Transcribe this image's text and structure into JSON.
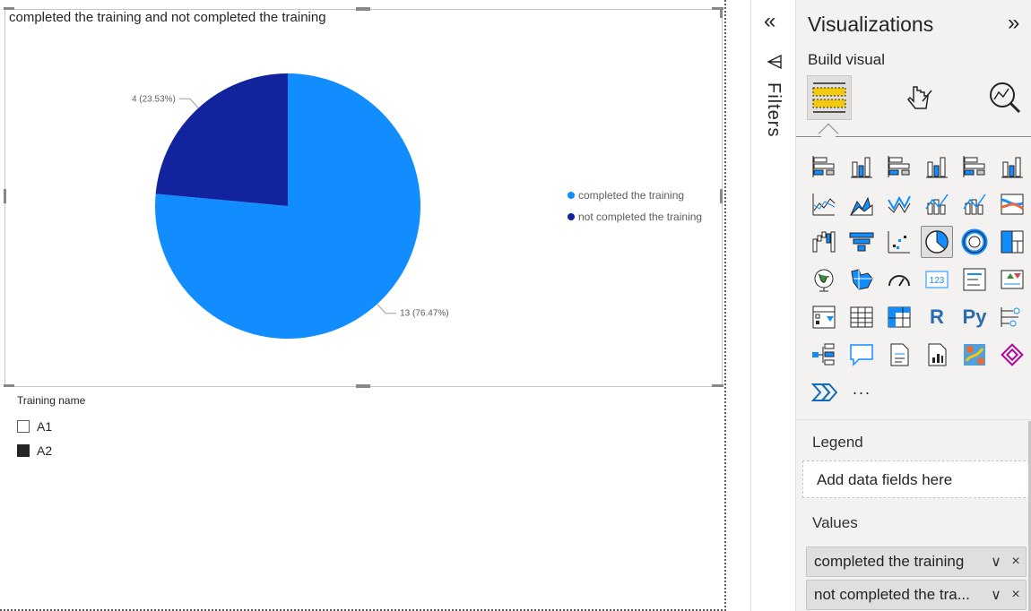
{
  "visual": {
    "title": "completed the training and not completed the training"
  },
  "chart_data": {
    "type": "pie",
    "title": "completed the training and not completed the training",
    "categories": [
      "completed the training",
      "not completed the training"
    ],
    "values": [
      13,
      4
    ],
    "percentages": [
      "76.47%",
      "23.53%"
    ],
    "data_labels": [
      "13 (76.47%)",
      "4 (23.53%)"
    ],
    "colors": [
      "#118DFF",
      "#12239E"
    ],
    "legend_position": "right"
  },
  "slicer": {
    "title": "Training name",
    "items": [
      {
        "label": "A1",
        "checked": false
      },
      {
        "label": "A2",
        "checked": true
      }
    ]
  },
  "filters": {
    "label": "Filters",
    "collapse_glyph": "«"
  },
  "viz_pane": {
    "title": "Visualizations",
    "expand_glyph": "»",
    "build_label": "Build visual",
    "tabs": [
      "build-visual-icon",
      "format-visual-icon",
      "analytics-icon"
    ],
    "selected_icon": "pie-chart-icon",
    "icons": [
      "stacked-bar-icon",
      "stacked-column-icon",
      "clustered-bar-icon",
      "clustered-column-icon",
      "100-stacked-bar-icon",
      "100-stacked-column-icon",
      "line-chart-icon",
      "area-chart-icon",
      "stacked-area-icon",
      "line-clustered-column-icon",
      "line-stacked-column-icon",
      "ribbon-chart-icon",
      "waterfall-icon",
      "funnel-icon",
      "scatter-icon",
      "pie-chart-icon",
      "donut-chart-icon",
      "treemap-icon",
      "map-icon",
      "filled-map-icon",
      "gauge-icon",
      "card-icon",
      "multi-row-card-icon",
      "kpi-icon",
      "slicer-icon",
      "table-icon",
      "matrix-icon",
      "r-visual-icon",
      "python-visual-icon",
      "key-influencers-icon",
      "decomposition-tree-icon",
      "qna-icon",
      "smart-narrative-icon",
      "paginated-report-icon",
      "azure-map-icon",
      "power-apps-icon",
      "power-automate-icon",
      "more-visuals-icon"
    ],
    "r_text": "R",
    "py_text": "Py",
    "card_text": "123",
    "more_text": "···",
    "legend_label": "Legend",
    "legend_placeholder": "Add data fields here",
    "values_label": "Values",
    "values": [
      "completed the training",
      "not completed the tra..."
    ],
    "chevron_glyph": "∨",
    "remove_glyph": "×"
  }
}
